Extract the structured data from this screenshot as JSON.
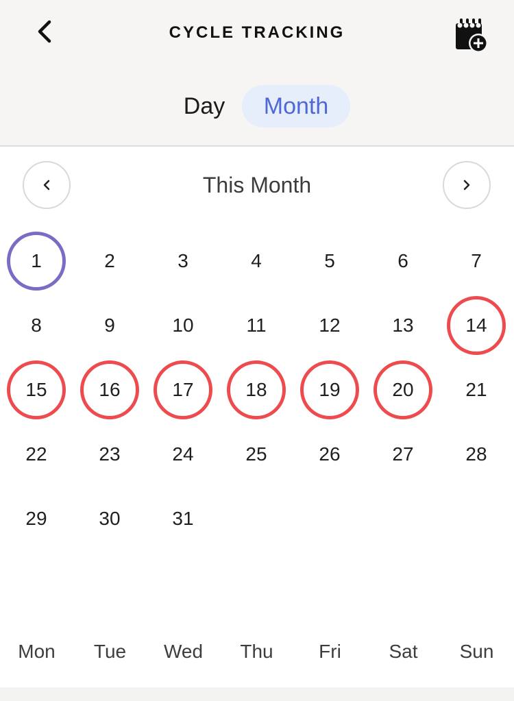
{
  "header": {
    "title": "CYCLE TRACKING",
    "back_icon": "chevron-left-icon",
    "add_icon": "calendar-add-icon"
  },
  "view_toggle": {
    "day_label": "Day",
    "month_label": "Month",
    "selected": "Month"
  },
  "month_nav": {
    "label": "This Month",
    "prev_icon": "chevron-left-icon",
    "next_icon": "chevron-right-icon"
  },
  "calendar": {
    "days": [
      "1",
      "2",
      "3",
      "4",
      "5",
      "6",
      "7",
      "8",
      "9",
      "10",
      "11",
      "12",
      "13",
      "14",
      "15",
      "16",
      "17",
      "18",
      "19",
      "20",
      "21",
      "22",
      "23",
      "24",
      "25",
      "26",
      "27",
      "28",
      "29",
      "30",
      "31"
    ],
    "today": "1",
    "marked_days": [
      "14",
      "15",
      "16",
      "17",
      "18",
      "19",
      "20"
    ],
    "weekdays": [
      "Mon",
      "Tue",
      "Wed",
      "Thu",
      "Fri",
      "Sat",
      "Sun"
    ]
  },
  "colors": {
    "accent": "#4e69d6",
    "toggle_bg": "#e6edfb",
    "today_ring": "#7a6cc4",
    "period_ring": "#ee4b4f",
    "header_bg": "#f6f5f3"
  }
}
